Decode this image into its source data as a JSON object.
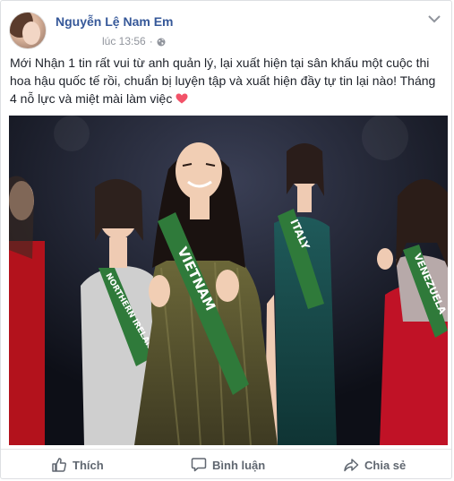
{
  "post": {
    "author_name": "Nguyễn Lệ Nam Em",
    "timestamp": "lúc 13:56",
    "separator": "·",
    "privacy_icon": "globe-icon",
    "menu_icon": "chevron-down-icon",
    "message": "Mới Nhận 1 tin rất vui từ anh quản lý, lại xuất hiện tại sân khấu một cuộc thi hoa hậu quốc tế rồi, chuẩn bị luyện tập và xuất hiện đầy tự tin lại nào! Tháng 4 nỗ lực và miệt mài làm việc",
    "message_emoji": "heart-icon",
    "photo": {
      "sash_labels": [
        "VIETNAM",
        "ITALY",
        "VENEZUELA",
        "NORTHERN IRELAND"
      ]
    }
  },
  "actions": {
    "like": {
      "label": "Thích",
      "icon": "thumbs-up-icon"
    },
    "comment": {
      "label": "Bình luận",
      "icon": "comment-icon"
    },
    "share": {
      "label": "Chia sẻ",
      "icon": "share-icon"
    }
  },
  "colors": {
    "author_link": "#365899",
    "meta_text": "#90949c",
    "action_text": "#606770",
    "heart": "#f25268"
  }
}
